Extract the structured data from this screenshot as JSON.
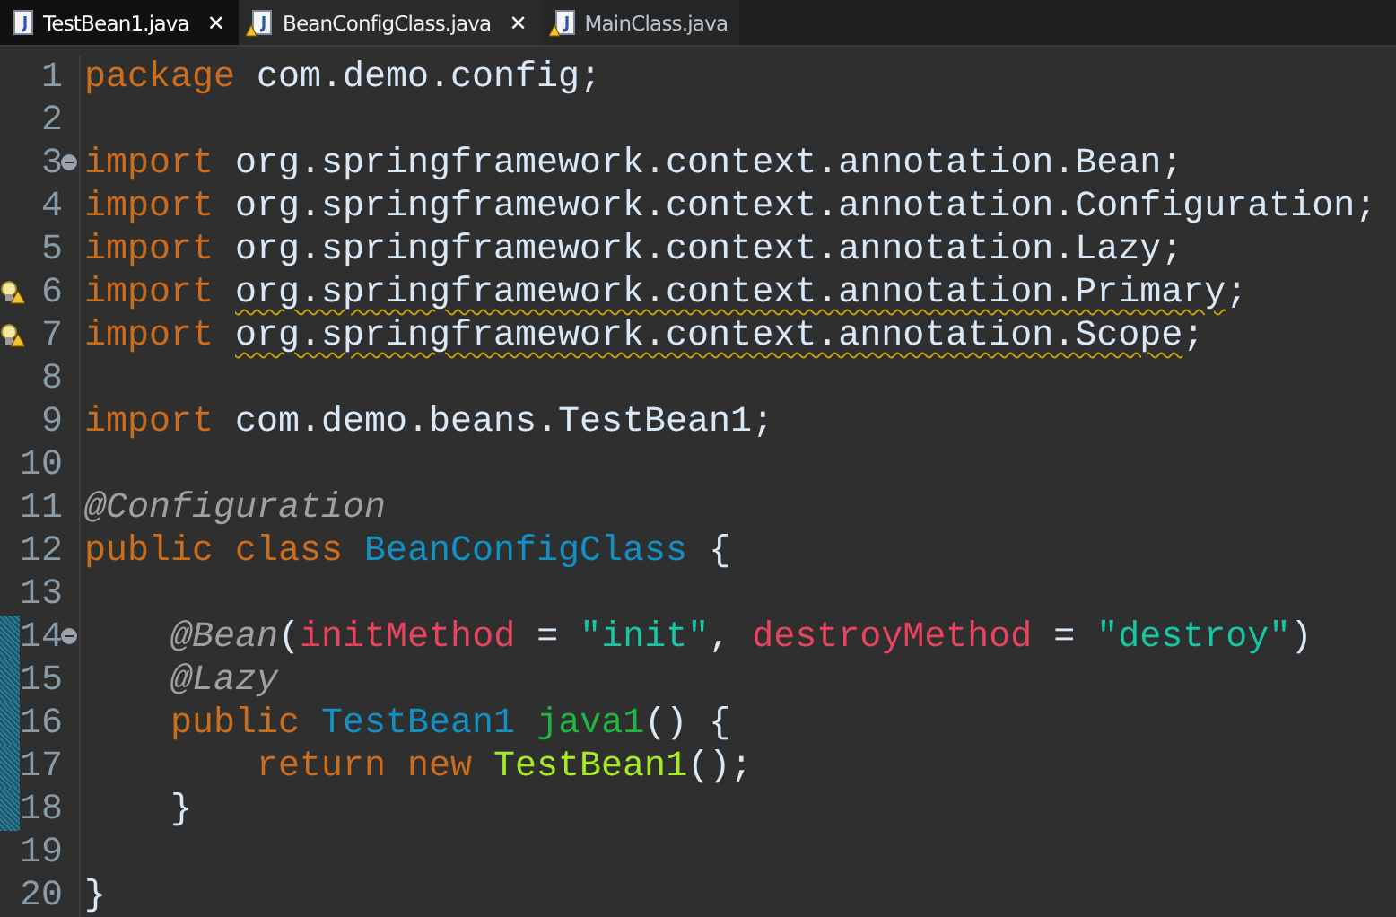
{
  "tabs": [
    {
      "label": "TestBean1.java",
      "selected": false,
      "warning": false,
      "closable": true
    },
    {
      "label": "BeanConfigClass.java",
      "selected": true,
      "warning": true,
      "closable": true
    },
    {
      "label": "MainClass.java",
      "selected": false,
      "warning": true,
      "closable": false
    }
  ],
  "close_glyph": "✕",
  "lines": [
    {
      "number": "1",
      "fold": false,
      "warning": false,
      "changed": false,
      "tokens": [
        {
          "kind": "keyword",
          "text": "package "
        },
        {
          "kind": "plain",
          "text": "com.demo.config;"
        }
      ]
    },
    {
      "number": "2",
      "fold": false,
      "warning": false,
      "changed": false
    },
    {
      "number": "3",
      "fold": true,
      "warning": false,
      "changed": false,
      "tokens": [
        {
          "kind": "keyword",
          "text": "import "
        },
        {
          "kind": "plain",
          "text": "org.springframework.context.annotation.Bean;"
        }
      ]
    },
    {
      "number": "4",
      "fold": false,
      "warning": false,
      "changed": false,
      "tokens": [
        {
          "kind": "keyword",
          "text": "import "
        },
        {
          "kind": "plain",
          "text": "org.springframework.context.annotation.Configuration;"
        }
      ]
    },
    {
      "number": "5",
      "fold": false,
      "warning": false,
      "changed": false,
      "tokens": [
        {
          "kind": "keyword",
          "text": "import "
        },
        {
          "kind": "plain",
          "text": "org.springframework.context.annotation.Lazy;"
        }
      ]
    },
    {
      "number": "6",
      "fold": false,
      "warning": true,
      "changed": false,
      "tokens": [
        {
          "kind": "keyword",
          "text": "import "
        },
        {
          "kind": "plain",
          "text": "org.springframework.context.annotation.Primary",
          "squiggle": true
        },
        {
          "kind": "plain",
          "text": ";"
        }
      ]
    },
    {
      "number": "7",
      "fold": false,
      "warning": true,
      "changed": false,
      "tokens": [
        {
          "kind": "keyword",
          "text": "import "
        },
        {
          "kind": "plain",
          "text": "org.springframework.context.annotation.Scope",
          "squiggle": true
        },
        {
          "kind": "plain",
          "text": ";"
        }
      ]
    },
    {
      "number": "8",
      "fold": false,
      "warning": false,
      "changed": false
    },
    {
      "number": "9",
      "fold": false,
      "warning": false,
      "changed": false,
      "tokens": [
        {
          "kind": "keyword",
          "text": "import "
        },
        {
          "kind": "plain",
          "text": "com.demo.beans.TestBean1;"
        }
      ]
    },
    {
      "number": "10",
      "fold": false,
      "warning": false,
      "changed": false
    },
    {
      "number": "11",
      "fold": false,
      "warning": false,
      "changed": false,
      "tokens": [
        {
          "kind": "annotation",
          "text": "@Configuration"
        }
      ]
    },
    {
      "number": "12",
      "fold": false,
      "warning": false,
      "changed": false,
      "tokens": [
        {
          "kind": "keyword",
          "text": "public class "
        },
        {
          "kind": "type",
          "text": "BeanConfigClass"
        },
        {
          "kind": "plain",
          "text": " {"
        }
      ]
    },
    {
      "number": "13",
      "fold": false,
      "warning": false,
      "changed": false
    },
    {
      "number": "14",
      "fold": true,
      "warning": false,
      "changed": true,
      "tokens": [
        {
          "kind": "annotation",
          "text": "    @Bean"
        },
        {
          "kind": "plain",
          "text": "("
        },
        {
          "kind": "param",
          "text": "initMethod"
        },
        {
          "kind": "plain",
          "text": " = "
        },
        {
          "kind": "string",
          "text": "\"init\""
        },
        {
          "kind": "plain",
          "text": ", "
        },
        {
          "kind": "param",
          "text": "destroyMethod"
        },
        {
          "kind": "plain",
          "text": " = "
        },
        {
          "kind": "string",
          "text": "\"destroy\""
        },
        {
          "kind": "plain",
          "text": ")"
        }
      ]
    },
    {
      "number": "15",
      "fold": false,
      "warning": false,
      "changed": true,
      "tokens": [
        {
          "kind": "annotation",
          "text": "    @Lazy"
        }
      ]
    },
    {
      "number": "16",
      "fold": false,
      "warning": false,
      "changed": true,
      "tokens": [
        {
          "kind": "keyword",
          "text": "    public "
        },
        {
          "kind": "type",
          "text": "TestBean1"
        },
        {
          "kind": "method",
          "text": " java1"
        },
        {
          "kind": "plain",
          "text": "() {"
        }
      ]
    },
    {
      "number": "17",
      "fold": false,
      "warning": false,
      "changed": true,
      "tokens": [
        {
          "kind": "keyword",
          "text": "        return new "
        },
        {
          "kind": "ctor",
          "text": "TestBean1"
        },
        {
          "kind": "plain",
          "text": "();"
        }
      ]
    },
    {
      "number": "18",
      "fold": false,
      "warning": false,
      "changed": true,
      "tokens": [
        {
          "kind": "plain",
          "text": "    }"
        }
      ]
    },
    {
      "number": "19",
      "fold": false,
      "warning": false,
      "changed": false
    },
    {
      "number": "20",
      "fold": false,
      "warning": false,
      "changed": false,
      "tokens": [
        {
          "kind": "plain",
          "text": "}"
        }
      ]
    }
  ]
}
